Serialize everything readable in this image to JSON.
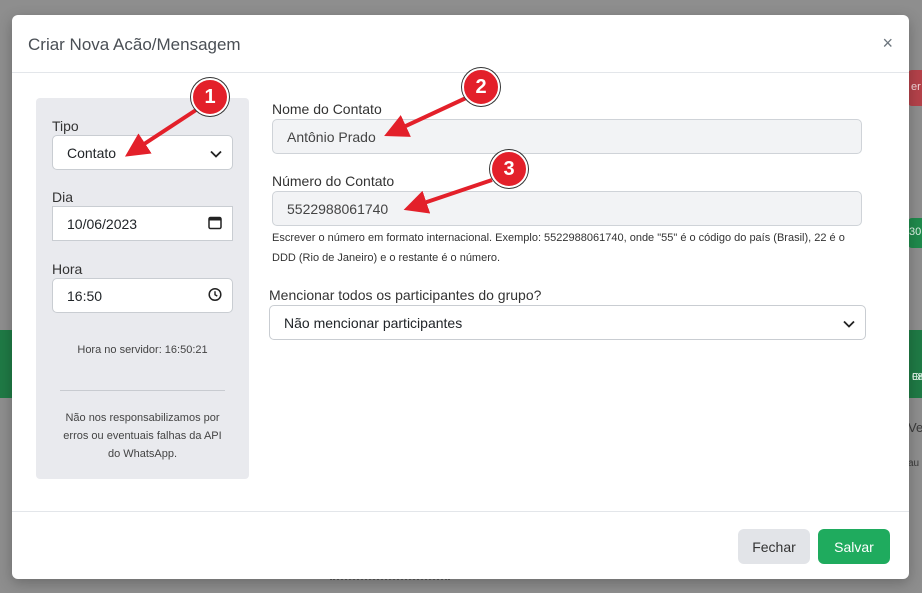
{
  "modal": {
    "title": "Criar Nova Acão/Mensagem",
    "close_glyph": "×"
  },
  "sidebar": {
    "tipo_label": "Tipo",
    "tipo_value": "Contato",
    "dia_label": "Dia",
    "dia_value": "10/06/2023",
    "hora_label": "Hora",
    "hora_value": "16:50",
    "server_time": "Hora no servidor: 16:50:21",
    "disclaimer_line1": "Não nos responsabilizamos por",
    "disclaimer_line2": "erros ou eventuais falhas da API",
    "disclaimer_line3": "do WhatsApp."
  },
  "form": {
    "nome_label": "Nome do Contato",
    "nome_value": "Antônio Prado",
    "numero_label": "Número do Contato",
    "numero_value": "5522988061740",
    "help_line1": "Escrever o número em formato internacional. Exemplo: 5522988061740, onde \"55\" é o código do país (Brasil), 22 é o",
    "help_line2": "DDD (Rio de Janeiro) e o restante é o número.",
    "mencionar_label": "Mencionar todos os participantes do grupo?",
    "mencionar_value": "Não mencionar participantes"
  },
  "footer": {
    "close_label": "Fechar",
    "save_label": "Salvar"
  },
  "annotations": {
    "badge_1": "1",
    "badge_2": "2",
    "badge_3": "3"
  },
  "background": {
    "red_frag": "er",
    "green_frag": "30",
    "green_frag2_a": "Er",
    "green_frag2_b": "08",
    "text_frag": "Ve",
    "text_frag2": "au"
  },
  "colors": {
    "accent_save": "#1fab5e",
    "annotation_red": "#e3202a"
  },
  "icons": {
    "select_chevron": "chevron-down-icon",
    "calendar": "calendar-icon",
    "clock": "clock-icon"
  }
}
